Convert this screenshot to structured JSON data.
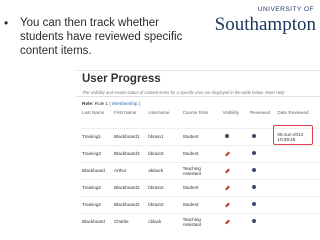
{
  "bullet": {
    "dot": "•",
    "text": "You can then track whether students have reviewed specific content items."
  },
  "logo": {
    "university_of": "UNIVERSITY OF",
    "name": "Southampton"
  },
  "screenshot": {
    "title": "User Progress",
    "description": "The visibility and review status of content items for a specific user are displayed in the table below. More Help",
    "role_label": "Role:",
    "role_value": "Rule 1",
    "role_link": "( Membership )",
    "columns": [
      "Last Name",
      "First Name",
      "Username",
      "Course Role",
      "Visibility",
      "Reviewed",
      "Date Reviewed"
    ],
    "rows": [
      {
        "last": "Training1",
        "first": "Blackboard1",
        "username": "bbrain1",
        "role": "Student",
        "visibility": "eye-icon",
        "reviewed": "check-icon",
        "date": "05-Jun-2014 10:39:45"
      },
      {
        "last": "Training3",
        "first": "Blackboard3",
        "username": "bbrain3",
        "role": "Student",
        "visibility": "pencil-icon",
        "reviewed": "check-icon",
        "date": ""
      },
      {
        "last": "Blackboard",
        "first": "Arthur",
        "username": "abback",
        "role": "Teaching Assistant",
        "visibility": "pencil-icon",
        "reviewed": "check-icon",
        "date": ""
      },
      {
        "last": "Training2",
        "first": "Blackboard2",
        "username": "bbrain2",
        "role": "Student",
        "visibility": "pencil-icon",
        "reviewed": "check-icon",
        "date": ""
      },
      {
        "last": "Training2",
        "first": "Blackboard2",
        "username": "bbrain3",
        "role": "Student",
        "visibility": "pencil-icon",
        "reviewed": "check-icon",
        "date": ""
      },
      {
        "last": "Blackboard",
        "first": "Charlie",
        "username": "cblack",
        "role": "Teaching Assistant",
        "visibility": "pencil-icon",
        "reviewed": "check-icon",
        "date": ""
      }
    ]
  },
  "colors": {
    "brand_navy": "#1c355e",
    "highlight_red": "#e0434f",
    "link_blue": "#2a6ab3"
  }
}
